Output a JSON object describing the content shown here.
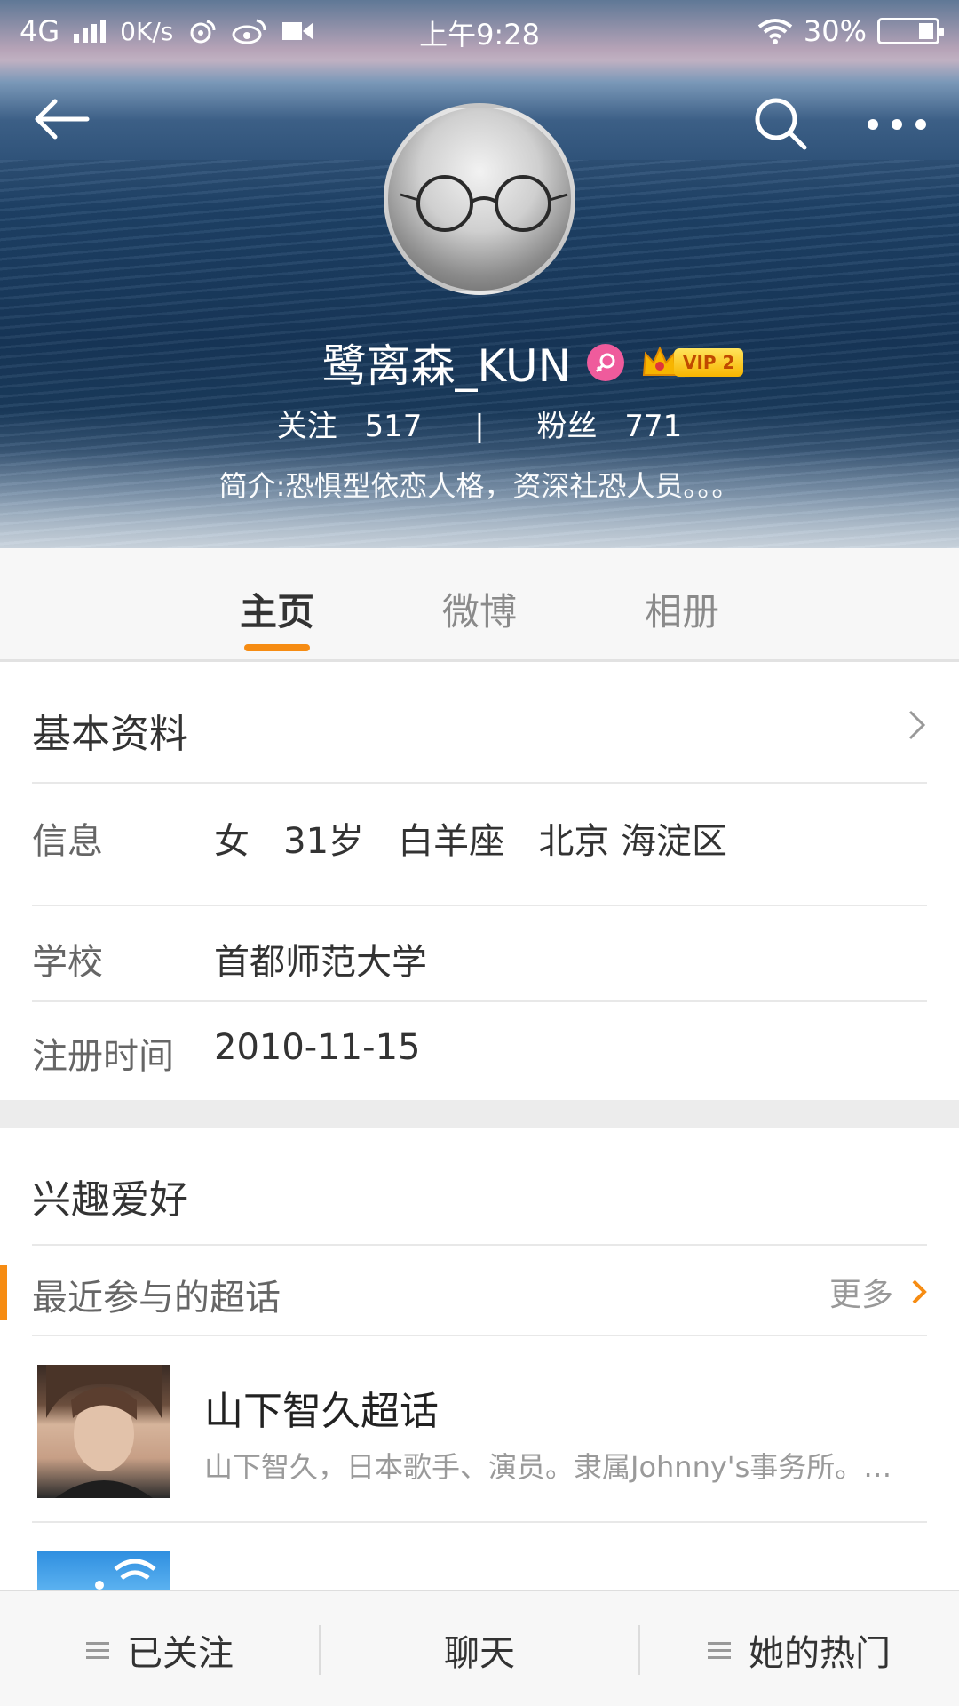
{
  "status_bar": {
    "network": "4G",
    "speed": "0K/s",
    "time": "上午9:28",
    "battery": "30%"
  },
  "profile": {
    "name": "鹭离森_KUN",
    "vip_label": "VIP 2",
    "following_label": "关注",
    "following_count": "517",
    "separator": "|",
    "followers_label": "粉丝",
    "followers_count": "771",
    "bio": "简介:恐惧型依恋人格，资深社恐人员。。。"
  },
  "tabs": [
    {
      "label": "主页",
      "active": true
    },
    {
      "label": "微博",
      "active": false
    },
    {
      "label": "相册",
      "active": false
    }
  ],
  "basic_info": {
    "title": "基本资料",
    "rows": [
      {
        "label": "信息",
        "value": "女   31岁   白羊座   北京 海淀区"
      },
      {
        "label": "学校",
        "value": "首都师范大学"
      },
      {
        "label": "注册时间",
        "value": "2010-11-15"
      }
    ]
  },
  "interests": {
    "title": "兴趣爱好",
    "subheader": "最近参与的超话",
    "more": "更多",
    "items": [
      {
        "title": "山下智久超话",
        "desc": "山下智久，日本歌手、演员。隶属Johnny's事务所。…"
      }
    ]
  },
  "bottom_bar": {
    "followed": "已关注",
    "chat": "聊天",
    "hot": "她的热门"
  },
  "colors": {
    "accent": "#f68c13",
    "female": "#ef5b9c"
  }
}
